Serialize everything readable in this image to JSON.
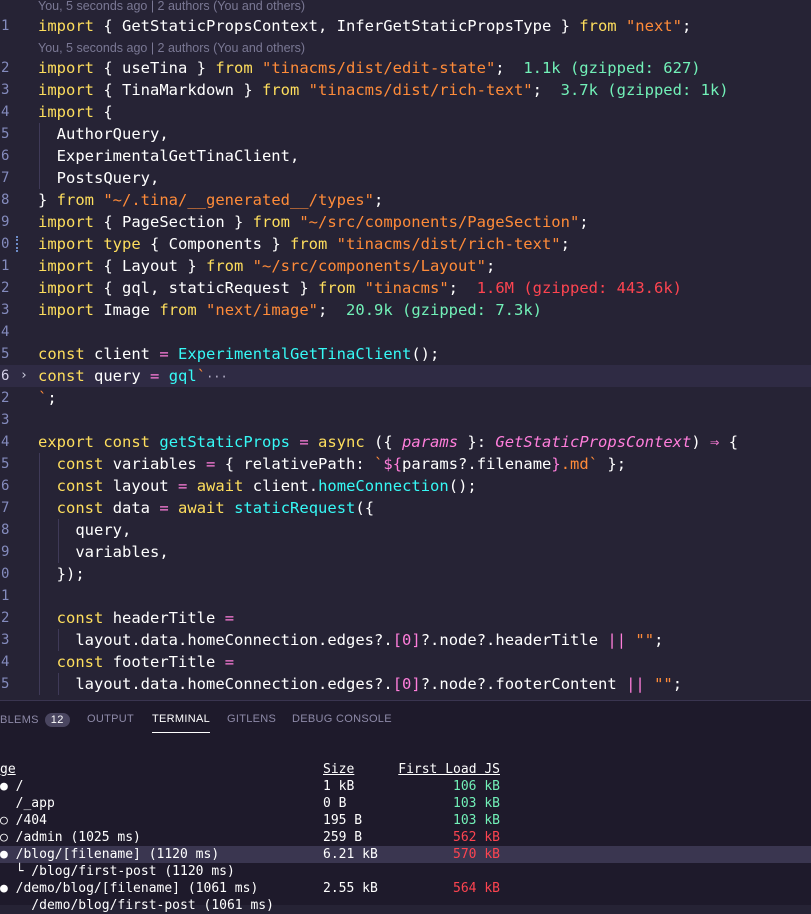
{
  "blame": [
    {
      "text": "You, 5 seconds ago | 2 authors (You and others)"
    },
    {
      "text": "You, 5 seconds ago | 2 authors (You and others)"
    }
  ],
  "lines": [
    {
      "num": "1",
      "code": "import { GetStaticPropsContext, InferGetStaticPropsType } from \"next\";"
    },
    {
      "num": "2",
      "code": "import { useTina } from \"tinacms/dist/edit-state\";",
      "size": "1.1k (gzipped: 627)"
    },
    {
      "num": "3",
      "code": "import { TinaMarkdown } from \"tinacms/dist/rich-text\";",
      "size": "3.7k (gzipped: 1k)"
    },
    {
      "num": "4",
      "code": "import {"
    },
    {
      "num": "5",
      "code": "  AuthorQuery,"
    },
    {
      "num": "6",
      "code": "  ExperimentalGetTinaClient,"
    },
    {
      "num": "7",
      "code": "  PostsQuery,"
    },
    {
      "num": "8",
      "code": "} from \"~/.tina/__generated__/types\";"
    },
    {
      "num": "9",
      "code": "import { PageSection } from \"~/src/components/PageSection\";"
    },
    {
      "num": "0",
      "code": "import type { Components } from \"tinacms/dist/rich-text\";"
    },
    {
      "num": "1",
      "code": "import { Layout } from \"~/src/components/Layout\";"
    },
    {
      "num": "2",
      "code": "import { gql, staticRequest } from \"tinacms\";",
      "size": "1.6M (gzipped: 443.6k)"
    },
    {
      "num": "3",
      "code": "import Image from \"next/image\";",
      "size": "20.9k (gzipped: 7.3k)"
    },
    {
      "num": "4",
      "code": ""
    },
    {
      "num": "5",
      "code": "const client = ExperimentalGetTinaClient();"
    },
    {
      "num": "6",
      "code": "const query = gql`",
      "collapsed": "···"
    },
    {
      "num": "2",
      "code": "`;"
    },
    {
      "num": "3",
      "code": ""
    },
    {
      "num": "4",
      "code": "export const getStaticProps = async ({ params }: GetStaticPropsContext) => {"
    },
    {
      "num": "5",
      "code": "  const variables = { relativePath: `${params?.filename}.md` };"
    },
    {
      "num": "6",
      "code": "  const layout = await client.homeConnection();"
    },
    {
      "num": "7",
      "code": "  const data = await staticRequest({"
    },
    {
      "num": "8",
      "code": "    query,"
    },
    {
      "num": "9",
      "code": "    variables,"
    },
    {
      "num": "0",
      "code": "  });"
    },
    {
      "num": "1",
      "code": ""
    },
    {
      "num": "2",
      "code": "  const headerTitle ="
    },
    {
      "num": "3",
      "code": "    layout.data.homeConnection.edges?.[0]?.node?.headerTitle || \"\";"
    },
    {
      "num": "4",
      "code": "  const footerTitle ="
    },
    {
      "num": "5",
      "code": "    layout.data.homeConnection.edges?.[0]?.node?.footerContent || \"\";"
    }
  ],
  "panel": {
    "tabs": [
      {
        "label": "BLEMS",
        "badge": "12"
      },
      {
        "label": "OUTPUT"
      },
      {
        "label": "TERMINAL",
        "active": true
      },
      {
        "label": "GITLENS"
      },
      {
        "label": "DEBUG CONSOLE"
      }
    ]
  },
  "terminal": {
    "header": {
      "route": "ge",
      "size": "Size",
      "first_load": "First Load JS"
    },
    "rows": [
      {
        "route": "● /",
        "size": "1 kB",
        "first_load": "106 kB",
        "status": "ok"
      },
      {
        "route": "  /_app",
        "size": "0 B",
        "first_load": "103 kB",
        "status": "ok"
      },
      {
        "route": "○ /404",
        "size": "195 B",
        "first_load": "103 kB",
        "status": "ok"
      },
      {
        "route": "○ /admin (1025 ms)",
        "size": "259 B",
        "first_load": "562 kB",
        "status": "bad"
      },
      {
        "route": "● /blog/[filename] (1120 ms)",
        "size": "6.21 kB",
        "first_load": "570 kB",
        "status": "bad",
        "selected": true
      },
      {
        "route": "  └ /blog/first-post (1120 ms)",
        "size": "",
        "first_load": "",
        "status": "none"
      },
      {
        "route": "● /demo/blog/[filename] (1061 ms)",
        "size": "2.55 kB",
        "first_load": "564 kB",
        "status": "bad"
      },
      {
        "route": "    /demo/blog/first-post (1061 ms)",
        "size": "",
        "first_load": "",
        "status": "none"
      }
    ]
  },
  "colors": {
    "background": "#262335",
    "keyword": "#fede5d",
    "string": "#ff8b39",
    "function": "#36f9f6",
    "param": "#ff7edb",
    "ok": "#72f1b8",
    "bad": "#fe4450"
  }
}
